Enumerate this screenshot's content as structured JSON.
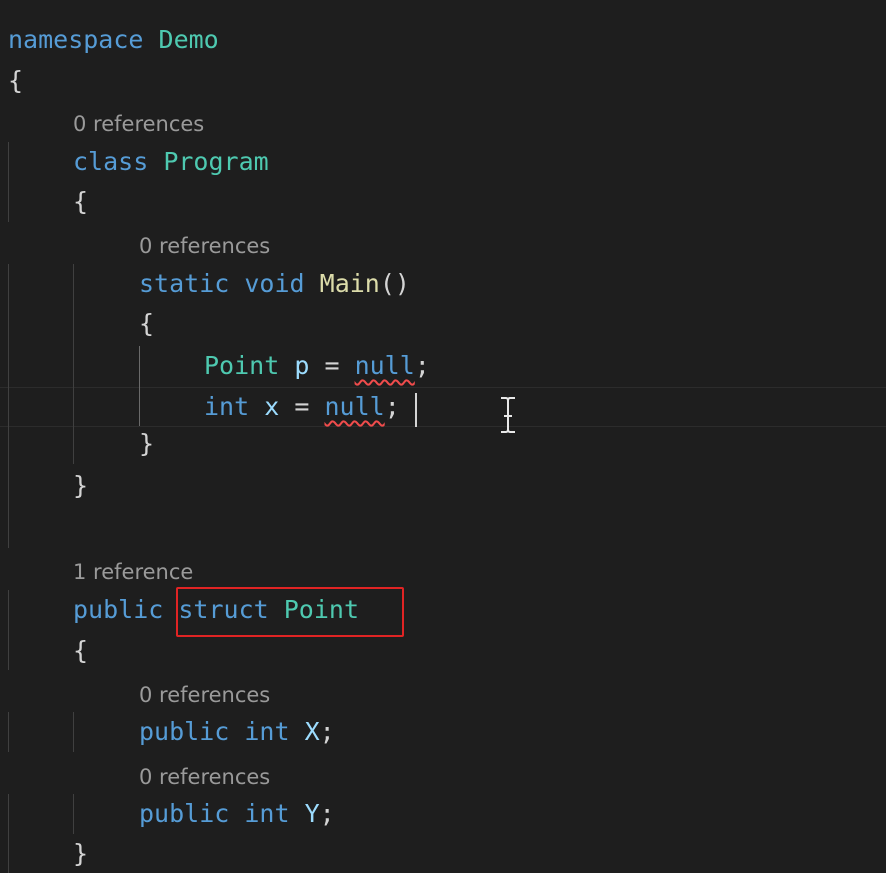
{
  "code": {
    "namespace_keyword": "namespace",
    "namespace_name": "Demo",
    "class_keyword": "class",
    "class_name": "Program",
    "open_brace": "{",
    "close_brace": "}",
    "static_keyword": "static",
    "void_keyword": "void",
    "main_name": "Main",
    "main_parens": "()",
    "point_type": "Point",
    "var_p": "p",
    "var_x": "x",
    "equals": "=",
    "null_keyword": "null",
    "semicolon": ";",
    "int_keyword": "int",
    "public_keyword": "public",
    "struct_keyword": "struct",
    "struct_name": "Point",
    "field_x": "X",
    "field_y": "Y"
  },
  "codelens": {
    "program_refs": "0 references",
    "main_refs": "0 references",
    "point_refs": "1 reference",
    "x_refs": "0 references",
    "y_refs": "0 references"
  },
  "colors": {
    "background": "#1e1e1e",
    "keyword": "#569cd6",
    "type": "#4ec9b0",
    "function": "#dcdcaa",
    "identifier": "#9cdcfe",
    "codelens": "#9a9a9a",
    "error_squiggle": "#f14c4c",
    "highlight_box": "#e02424"
  },
  "annotations": {
    "highlighted_code": "struct Point"
  },
  "editor_state": {
    "error_squiggles_on": [
      "null (line p)",
      "null (line x)"
    ],
    "cursor": "end of int x = null;"
  }
}
